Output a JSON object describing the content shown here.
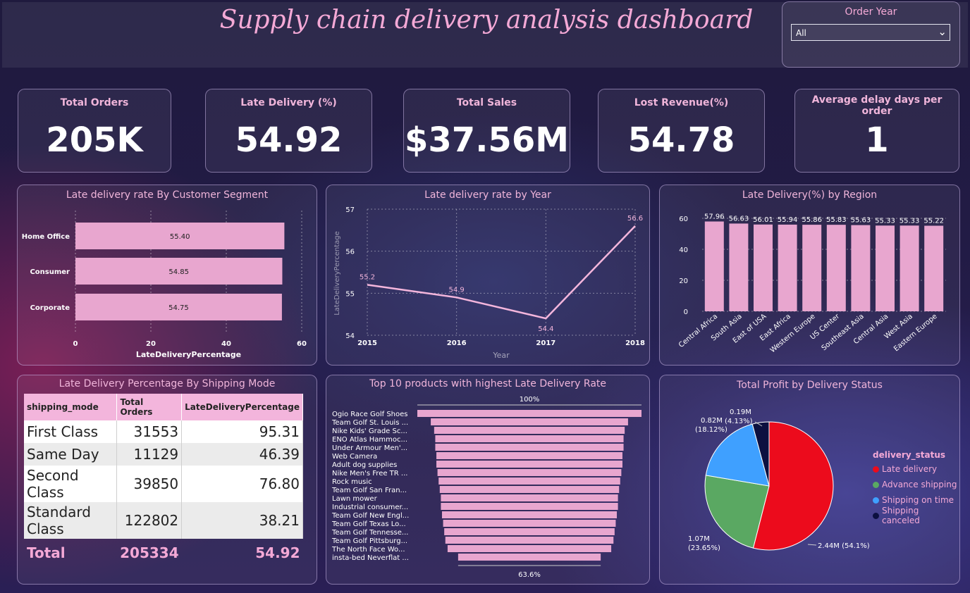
{
  "header": {
    "title": "Supply chain delivery analysis dashboard",
    "slicer_title": "Order Year",
    "slicer_value": "All"
  },
  "kpis": [
    {
      "label": "Total Orders",
      "value": "205K"
    },
    {
      "label": "Late Delivery (%)",
      "value": "54.92"
    },
    {
      "label": "Total Sales",
      "value": "$37.56M"
    },
    {
      "label": "Lost Revenue(%)",
      "value": "54.78"
    },
    {
      "label": "Average delay days per order",
      "value": "1"
    }
  ],
  "colors": {
    "bar_pink": "#e8a6cf",
    "line_pink": "#f4b6dc",
    "title_pink": "#f0b5da",
    "late": "#ec0b1c",
    "advance": "#5aa862",
    "ontime": "#3fa0ff",
    "canceled": "#0c1040"
  },
  "chart_data": [
    {
      "type": "bar",
      "orientation": "horizontal",
      "title": "Late delivery rate By Customer Segment",
      "categories": [
        "Home Office",
        "Consumer",
        "Corporate"
      ],
      "values": [
        55.4,
        54.85,
        54.75
      ],
      "value_labels": [
        "55.40",
        "54.85",
        "54.75"
      ],
      "xlabel": "LateDeliveryPercentage",
      "xlim": [
        0,
        60
      ],
      "xticks": [
        "0",
        "20",
        "40",
        "60"
      ],
      "grid": true
    },
    {
      "type": "line",
      "title": "Late delivery rate by Year",
      "x": [
        "2015",
        "2016",
        "2017",
        "2018"
      ],
      "values": [
        55.2,
        54.9,
        54.4,
        56.6
      ],
      "value_labels": [
        "55.2",
        "54.9",
        "54.4",
        "56.6"
      ],
      "xlabel": "Year",
      "ylabel": "LateDeliveryPercentage",
      "ylim": [
        54,
        57
      ],
      "yticks": [
        "54",
        "55",
        "56",
        "57"
      ],
      "grid": true
    },
    {
      "type": "bar",
      "title": "Late Delivery(%) by Region",
      "categories": [
        "Central Africa",
        "South Asia",
        "East of USA",
        "East Africa",
        "Western Europe",
        "US Center",
        "Southeast Asia",
        "Central Asia",
        "West Asia",
        "Eastern Europe"
      ],
      "values": [
        57.96,
        56.63,
        56.01,
        55.94,
        55.86,
        55.83,
        55.63,
        55.33,
        55.33,
        55.22
      ],
      "value_labels": [
        "57.96",
        "56.63",
        "56.01",
        "55.94",
        "55.86",
        "55.83",
        "55.63",
        "55.33",
        "55.33",
        "55.22"
      ],
      "ylim": [
        0,
        60
      ],
      "yticks": [
        "0",
        "20",
        "40",
        "60"
      ],
      "grid": true
    },
    {
      "type": "table",
      "title": "Late Delivery Percentage By Shipping Mode",
      "columns": [
        "shipping_mode",
        "Total Orders",
        "LateDeliveryPercentage"
      ],
      "rows": [
        [
          "First Class",
          "31553",
          "95.31"
        ],
        [
          "Same Day",
          "11129",
          "46.39"
        ],
        [
          "Second Class",
          "39850",
          "76.80"
        ],
        [
          "Standard Class",
          "122802",
          "38.21"
        ]
      ],
      "total": [
        "Total",
        "205334",
        "54.92"
      ]
    },
    {
      "type": "bar",
      "subtype": "funnel",
      "title": "Top 10 products with highest Late Delivery Rate",
      "categories": [
        "Ogio Race Golf Shoes",
        "Team Golf St. Louis ...",
        "Nike Kids' Grade Sc...",
        "ENO Atlas Hammoc...",
        "Under Armour Men'...",
        "Web Camera",
        "Adult dog supplies",
        "Nike Men's Free TR ...",
        "Rock music",
        "Team Golf San Fran...",
        "Lawn mower",
        "Industrial consumer...",
        "Team Golf New Engl...",
        "Team Golf Texas Lo...",
        "Team Golf Tennesse...",
        "Team Golf Pittsburg...",
        "The North Face Wo...",
        "insta-bed Neverflat ..."
      ],
      "values": [
        100,
        88,
        85,
        84,
        84,
        83,
        83,
        82,
        81,
        80,
        79,
        79,
        78,
        77,
        76,
        75,
        73,
        63.6
      ],
      "top_label": "100%",
      "bottom_label": "63.6%"
    },
    {
      "type": "pie",
      "title": "Total Profit by Delivery Status",
      "legend_title": "delivery_status",
      "legend_position": "right",
      "labels": [
        "Late delivery",
        "Advance shipping",
        "Shipping on time",
        "Shipping canceled"
      ],
      "values": [
        2.44,
        1.07,
        0.82,
        0.19
      ],
      "value_labels": [
        "2.44M (54.1%)",
        "1.07M",
        "0.82M",
        "0.19M"
      ],
      "percent_labels": [
        "(54.1%)",
        "(23.65%)",
        "(18.12%)",
        "(4.13%)"
      ]
    }
  ]
}
